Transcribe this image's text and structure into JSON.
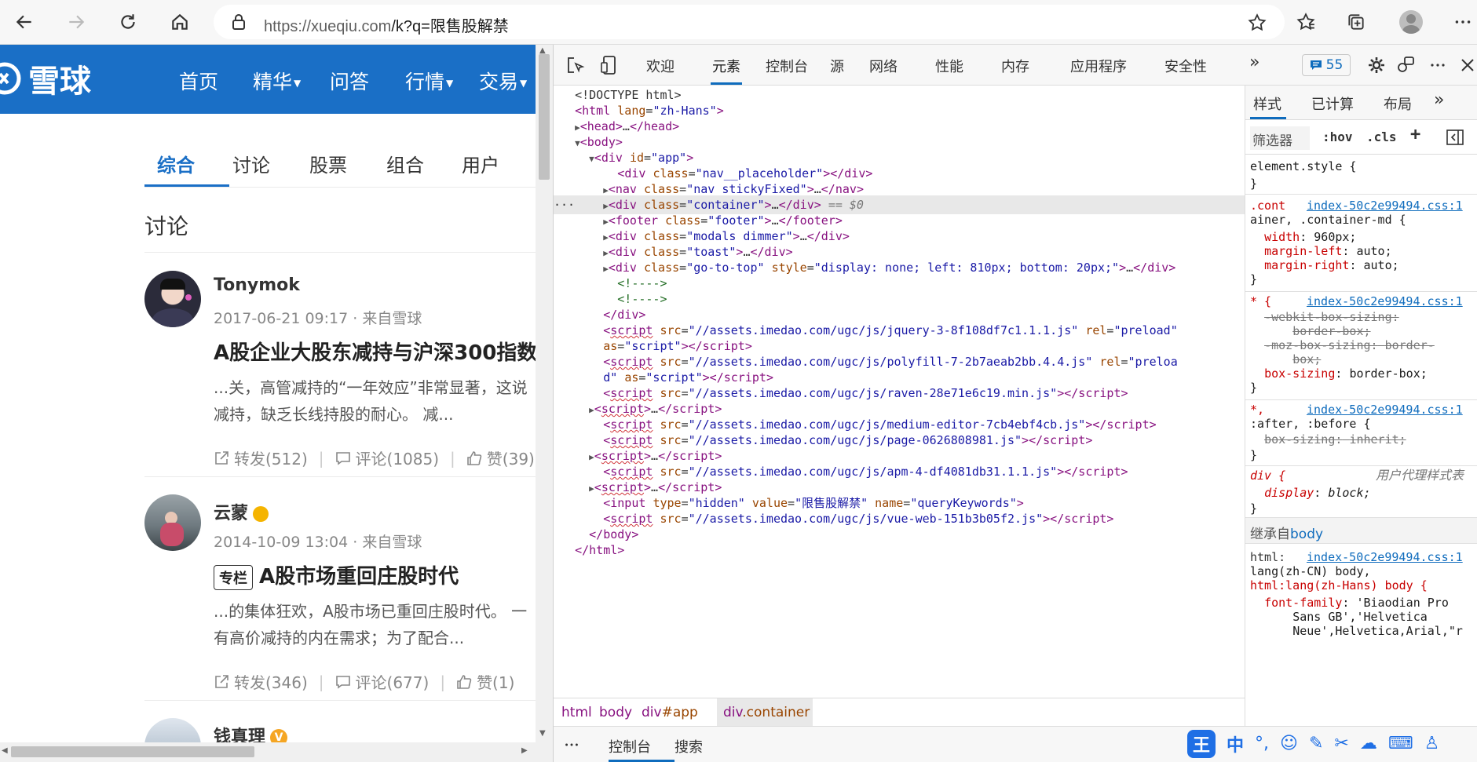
{
  "browser": {
    "url_host": "https://xueqiu.com",
    "url_path": "/k?q=限售股解禁"
  },
  "site": {
    "logo": "雪球",
    "nav": [
      "首页",
      "精华",
      "问答",
      "行情",
      "交易"
    ],
    "tabs": [
      "综合",
      "讨论",
      "股票",
      "组合",
      "用户"
    ],
    "section_title": "讨论",
    "posts": [
      {
        "author": "Tonymok",
        "meta": "2017-06-21 09:17 · 来自雪球",
        "title": "A股企业大股东减持与沪深300指数",
        "body1": "...关，高管减持的“一年效应”非常显著，这说",
        "body2": "减持，缺乏长线持股的耐心。 减...",
        "repost": "转发(512)",
        "comment": "评论(1085)",
        "like": "赞(39)"
      },
      {
        "author": "云蒙",
        "meta": "2014-10-09 13:04 · 来自雪球",
        "tag": "专栏",
        "title": "A股市场重回庄股时代",
        "body1": "...的集体狂欢，A股市场已重回庄股时代。 一",
        "body2": "有高价减持的内在需求；为了配合...",
        "repost": "转发(346)",
        "comment": "评论(677)",
        "like": "赞(1)"
      },
      {
        "author": "钱真理",
        "badge": "V"
      }
    ]
  },
  "devtools": {
    "tabs": [
      "欢迎",
      "元素",
      "控制台",
      "源",
      "网络",
      "性能",
      "内存",
      "应用程序",
      "安全性"
    ],
    "issues_count": "55",
    "dom": {
      "doctype": "<!DOCTYPE html>",
      "html_open_tag": "html",
      "html_lang_attr": "lang",
      "html_lang_val": "\"zh-Hans\"",
      "head": "head",
      "body": "body",
      "div": "div",
      "nav": "nav",
      "footer": "footer",
      "script": "script",
      "input": "input",
      "id_attr": "id",
      "class_attr": "class",
      "style_attr": "style",
      "src_attr": "src",
      "rel_attr": "rel",
      "as_attr": "as",
      "type_attr": "type",
      "value_attr": "value",
      "name_attr": "name",
      "app_id": "\"app\"",
      "nav_placeholder": "\"nav__placeholder\"",
      "nav_class": "\"nav stickyFixed\"",
      "container_class": "\"container\"",
      "footer_class": "\"footer\"",
      "modals_class": "\"modals dimmer\"",
      "toast_class": "\"toast\"",
      "gototop_class": "\"go-to-top\"",
      "gototop_style": "\"display: none; left: 810px; bottom: 20px;\"",
      "comment": "<!---->",
      "selected_marker": "== $0",
      "ellipsis": "…",
      "preload": "\"preload\"",
      "as_script": "\"script\"",
      "as_script_tail": "d\"",
      "preloa": "\"preloa",
      "jquery": "\"//assets.imedao.com/ugc/js/jquery-3-8f108df7c1.1.1.js\"",
      "polyfill": "\"//assets.imedao.com/ugc/js/polyfill-7-2b7aeab2bb.4.4.js\"",
      "raven": "\"//assets.imedao.com/ugc/js/raven-28e71e6c19.min.js\"",
      "medium": "\"//assets.imedao.com/ugc/js/medium-editor-7cb4ebf4cb.js\"",
      "page": "\"//assets.imedao.com/ugc/js/page-0626808981.js\"",
      "apm": "\"//assets.imedao.com/ugc/js/apm-4-df4081db31.1.1.js\"",
      "vue": "\"//assets.imedao.com/ugc/js/vue-web-151b3b05f2.js\"",
      "hidden": "\"hidden\"",
      "query_value": "\"限售股解禁\"",
      "query_name": "\"queryKeywords\""
    },
    "breadcrumbs": [
      "html",
      "body",
      "div",
      "#app",
      "div",
      ".container"
    ],
    "drawer_tabs": [
      "控制台",
      "搜索"
    ],
    "styles": {
      "tabs": [
        "样式",
        "已计算",
        "布局"
      ],
      "filter": "筛选器",
      "hov": ":hov",
      "cls": ".cls",
      "element_style": "element.style {",
      "close_brace": "}",
      "src_link": "index-50c2e99494.css:1",
      "rule1_sel_a": ".cont",
      "rule1_sel_b": "ainer, .container-md {",
      "rule1_p1": "width",
      "rule1_v1": "960px;",
      "rule1_p2": "margin-left",
      "rule1_v2": "auto;",
      "rule1_p3": "margin-right",
      "rule1_v3": "auto;",
      "rule2_sel": "* {",
      "rule2_p1": "-webkit-box-sizing:",
      "rule2_v1": "border-box;",
      "rule2_p2": "-moz-box-sizing:",
      "rule2_v2a": "border-",
      "rule2_v2b": "box;",
      "rule2_p3": "box-sizing",
      "rule2_v3": "border-box;",
      "rule3_sel_a": "*,",
      "rule3_sel_b": ":after, :before {",
      "rule3_p1": "box-sizing:",
      "rule3_v1": "inherit;",
      "rule4_sel": "div {",
      "ua_label": "用户代理样式表",
      "rule4_p1": "display",
      "rule4_v1": "block;",
      "inherited_label": "继承自",
      "inherited_from": "body",
      "rule5_a": "html:",
      "rule5_b": "lang(zh-CN) body,",
      "rule5_c": "html:lang(zh-Hans) body {",
      "rule5_p1": "font-family",
      "rule5_v1": "'Biaodian Pro",
      "rule5_v2": "Sans GB','Helvetica",
      "rule5_v3": "Neue',Helvetica,Arial,\"r"
    }
  },
  "ime": {
    "logo": "王",
    "lang": "中"
  }
}
